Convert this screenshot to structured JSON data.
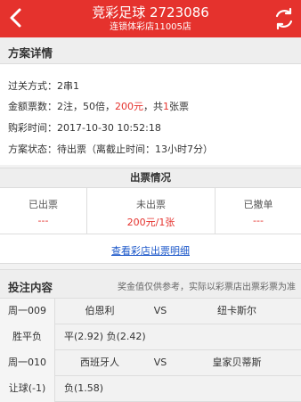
{
  "header": {
    "title": "竞彩足球  2723086",
    "subtitle": "连锁体彩店11005店",
    "bg_color": "#e5322d",
    "back_icon": "chevron-left-icon",
    "refresh_icon": "refresh-icon"
  },
  "plan": {
    "section_title": "方案详情",
    "pass_label": "过关方式：",
    "pass_value": "2串1",
    "amount_label": "金额票数：",
    "amount_prefix": "2注，50倍，",
    "amount_money": "200元",
    "amount_mid": "，共",
    "amount_count": "1",
    "amount_suffix": "张票",
    "buy_time_label": "购彩时间：",
    "buy_time_value": "2017-10-30 10:52:18",
    "status_label": "方案状态：",
    "status_value": "待出票（离截止时间：13小时7分）"
  },
  "ticket": {
    "title": "出票情况",
    "issued_label": "已出票",
    "issued_value": "---",
    "pending_label": "未出票",
    "pending_value": "200元/1张",
    "cancelled_label": "已撤单",
    "cancelled_value": "---",
    "detail_link": "查看彩店出票明细"
  },
  "bet": {
    "section_title": "投注内容",
    "note": "奖金值仅供参考，实际以彩票店出票彩票为准",
    "rows": [
      {
        "label": "周一009",
        "home": "伯恩利",
        "vs": "VS",
        "away": "纽卡斯尔"
      },
      {
        "label": "胜平负",
        "odds": "平(2.92) 负(2.42)"
      },
      {
        "label": "周一010",
        "home": "西班牙人",
        "vs": "VS",
        "away": "皇家贝蒂斯"
      },
      {
        "label": "让球(-1)",
        "odds": "负(1.58)"
      }
    ]
  }
}
